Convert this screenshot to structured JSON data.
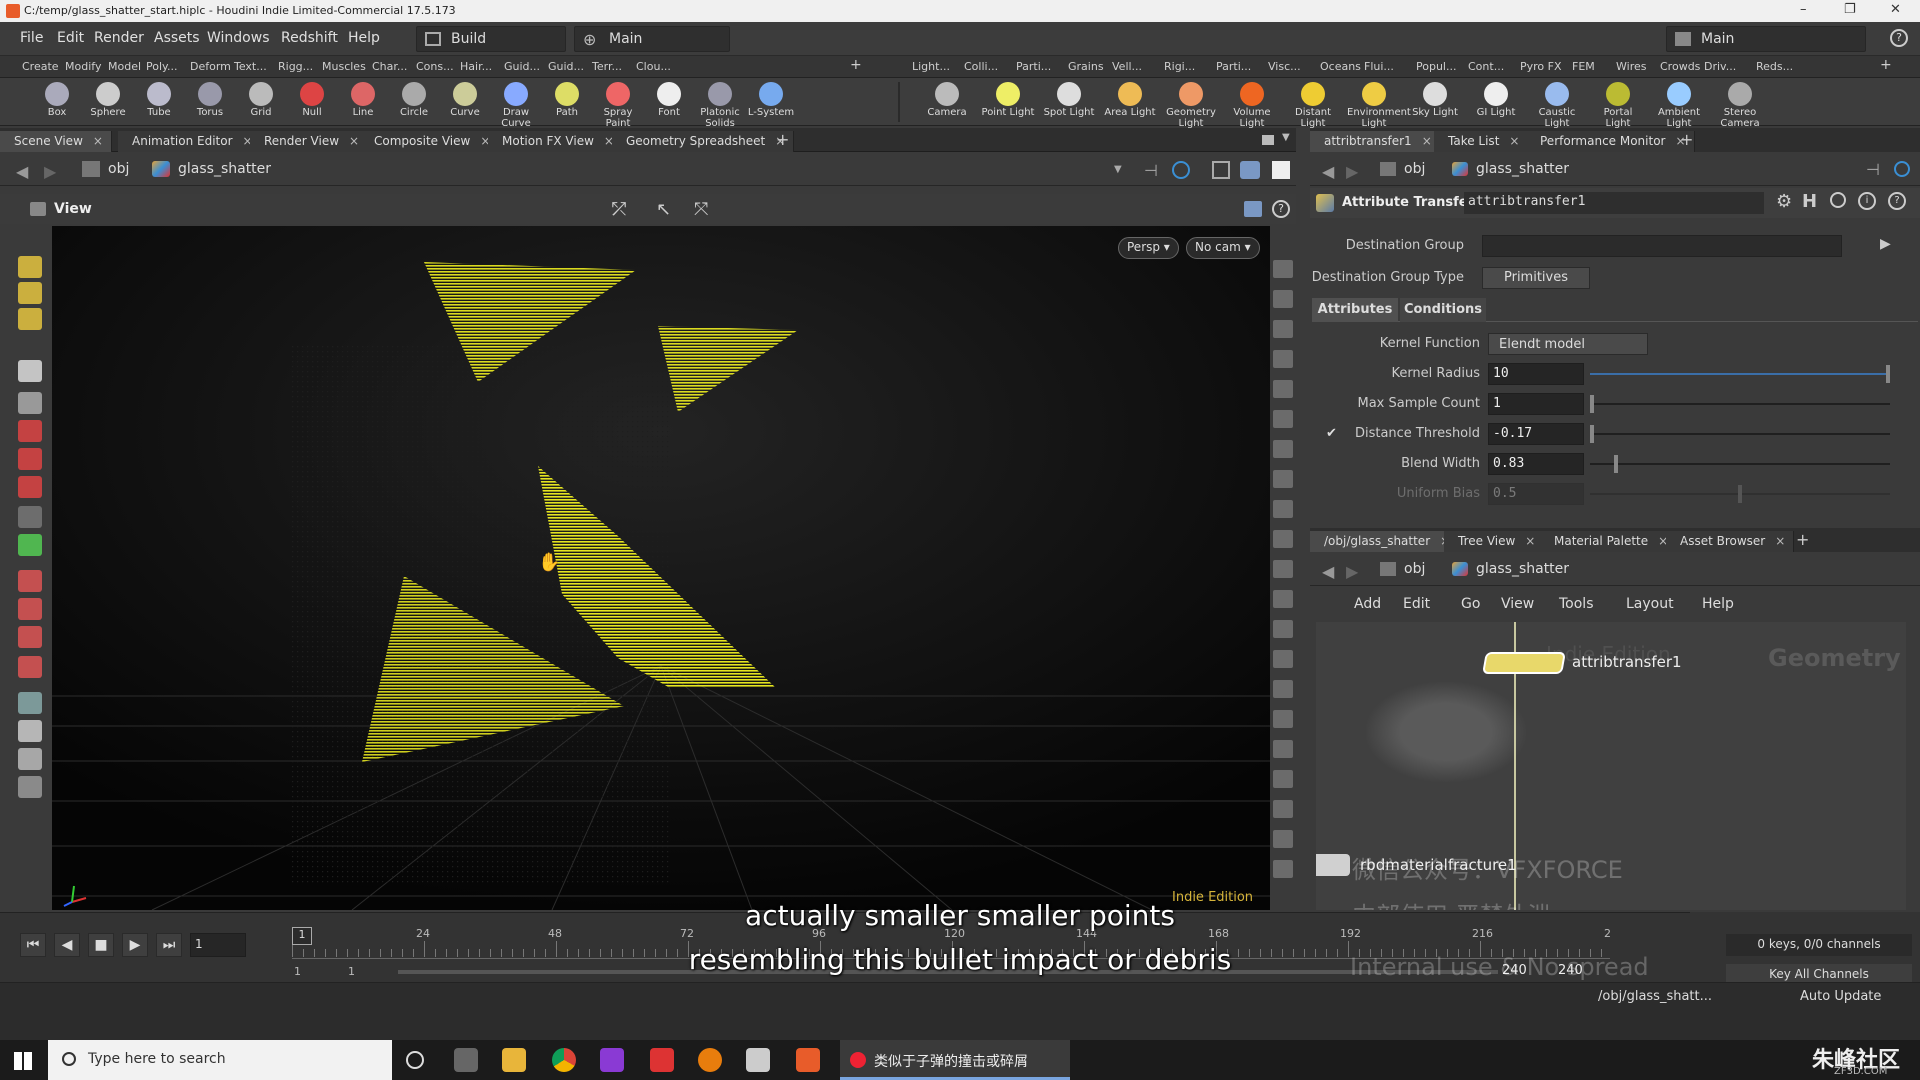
{
  "window": {
    "title": "C:/temp/glass_shatter_start.hiplc - Houdini Indie Limited-Commercial 17.5.173",
    "minimize": "–",
    "maximize": "❐",
    "close": "✕"
  },
  "menubar": {
    "items": [
      "File",
      "Edit",
      "Render",
      "Assets",
      "Windows",
      "Redshift",
      "Help"
    ],
    "desktop": "Build",
    "desk": "Main",
    "right_desk": "Main",
    "help_icon": "?"
  },
  "shelf_left": {
    "tabs": [
      "Create",
      "Modify",
      "Model",
      "Poly...",
      "Deform",
      "Text...",
      "Rigg...",
      "Muscles",
      "Char...",
      "Cons...",
      "Hair...",
      "Guid...",
      "Guid...",
      "Terr...",
      "Clou..."
    ],
    "tools": [
      "Box",
      "Sphere",
      "Tube",
      "Torus",
      "Grid",
      "Null",
      "Line",
      "Circle",
      "Curve",
      "Draw Curve",
      "Path",
      "Spray Paint",
      "Font",
      "Platonic Solids",
      "L-System"
    ]
  },
  "shelf_right": {
    "tabs": [
      "Light...",
      "Colli...",
      "Parti...",
      "Grains",
      "Vell...",
      "Rigi...",
      "Parti...",
      "Visc...",
      "Oceans",
      "Flui...",
      "Popul...",
      "Cont...",
      "Pyro FX",
      "FEM",
      "Wires",
      "Crowds",
      "Driv...",
      "Reds..."
    ],
    "tools": [
      "Camera",
      "Point Light",
      "Spot Light",
      "Area Light",
      "Geometry Light",
      "Volume Light",
      "Distant Light",
      "Environment Light",
      "Sky Light",
      "GI Light",
      "Caustic Light",
      "Portal Light",
      "Ambient Light",
      "Stereo Camera"
    ]
  },
  "left_pane": {
    "tabs": [
      "Scene View",
      "Animation Editor",
      "Render View",
      "Composite View",
      "Motion FX View",
      "Geometry Spreadsheet"
    ],
    "add": "+",
    "path_obj": "obj",
    "path_node": "glass_shatter",
    "view_label": "View",
    "persp": "Persp ▾",
    "cam": "No cam ▾",
    "indie": "Indie Edition"
  },
  "param_pane": {
    "tabs": [
      "attribtransfer1",
      "Take List",
      "Performance Monitor"
    ],
    "path_obj": "obj",
    "path_node": "glass_shatter",
    "node_type": "Attribute Transfer",
    "node_name": "attribtransfer1",
    "dest_group_label": "Destination Group",
    "dest_group_value": "",
    "dest_group_type_label": "Destination Group Type",
    "dest_group_type_value": "Primitives",
    "subtabs": [
      "Attributes",
      "Conditions"
    ],
    "kernel_label": "Kernel Function",
    "kernel_value": "Elendt model",
    "params": [
      {
        "label": "Kernel Radius",
        "value": "10",
        "slider": 1.0
      },
      {
        "label": "Max Sample Count",
        "value": "1",
        "slider": 0.0
      },
      {
        "label": "Distance Threshold",
        "value": "-0.17",
        "slider": 0.0,
        "checked": true
      },
      {
        "label": "Blend Width",
        "value": "0.83",
        "slider": 0.08
      },
      {
        "label": "Uniform Bias",
        "value": "0.5",
        "slider": 0.5
      }
    ]
  },
  "net_pane": {
    "tabs": [
      "/obj/glass_shatter",
      "Tree View",
      "Material Palette",
      "Asset Browser"
    ],
    "path_obj": "obj",
    "path_node": "glass_shatter",
    "menu": [
      "Add",
      "Edit",
      "Go",
      "View",
      "Tools",
      "Layout",
      "Help"
    ],
    "context": "Geometry",
    "indie": "Indie Edition",
    "node1": "attribtransfer1",
    "node2": "rbdmaterialfracture1"
  },
  "watermarks": {
    "line1": "微信公众号：VFXFORCE",
    "line2": "内部使用 严禁外泄",
    "line3": "Internal use & No spread",
    "corner": "朱峰社区",
    "corner_sub": "ZF3D.COM"
  },
  "subtitles": [
    "actually smaller smaller points",
    "resembling this bullet impact or debris"
  ],
  "timeline": {
    "frame": "1",
    "ticks": [
      "1",
      "24",
      "48",
      "72",
      "96",
      "120",
      "144",
      "168",
      "192",
      "216",
      "2"
    ],
    "start": "1",
    "start2": "1",
    "end": "240",
    "end2": "240",
    "keys": "0 keys, 0/0 channels",
    "key_all": "Key All Channels",
    "auto": "AUTO"
  },
  "status": {
    "path": "/obj/glass_shatt...",
    "update": "Auto Update"
  },
  "taskbar": {
    "search": "Type here to search",
    "app_title": "类似于子弹的撞击或碎屑"
  }
}
